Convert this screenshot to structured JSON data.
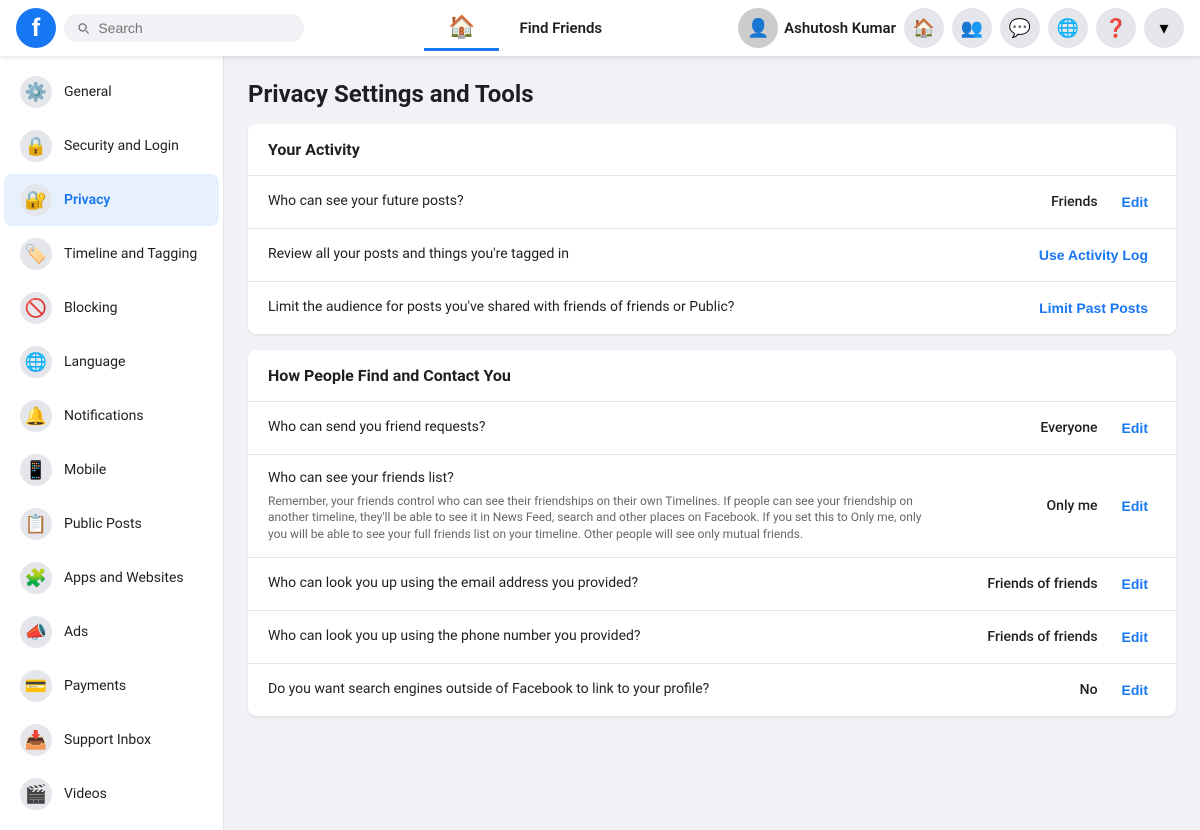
{
  "topnav": {
    "logo": "f",
    "search_placeholder": "Search",
    "user_name": "Ashutosh Kumar",
    "nav_items": [
      {
        "label": "Home",
        "icon": "🏠",
        "active": false
      },
      {
        "label": "Find Friends",
        "icon": "👥",
        "active": false
      }
    ],
    "icon_buttons": [
      {
        "name": "friends-icon",
        "symbol": "👤"
      },
      {
        "name": "messenger-icon",
        "symbol": "💬"
      },
      {
        "name": "globe-icon",
        "symbol": "🌐"
      },
      {
        "name": "help-icon",
        "symbol": "❓"
      },
      {
        "name": "chevron-icon",
        "symbol": "▾"
      }
    ]
  },
  "sidebar": {
    "items": [
      {
        "id": "general",
        "label": "General",
        "icon": "⚙️",
        "active": false
      },
      {
        "id": "security",
        "label": "Security and Login",
        "icon": "🔒",
        "active": false
      },
      {
        "id": "privacy",
        "label": "Privacy",
        "icon": "🔐",
        "active": true
      },
      {
        "id": "timeline",
        "label": "Timeline and Tagging",
        "icon": "🏷️",
        "active": false
      },
      {
        "id": "blocking",
        "label": "Blocking",
        "icon": "🚫",
        "active": false
      },
      {
        "id": "language",
        "label": "Language",
        "icon": "🌐",
        "active": false
      },
      {
        "id": "notifications",
        "label": "Notifications",
        "icon": "🔔",
        "active": false
      },
      {
        "id": "mobile",
        "label": "Mobile",
        "icon": "📱",
        "active": false
      },
      {
        "id": "public-posts",
        "label": "Public Posts",
        "icon": "📋",
        "active": false
      },
      {
        "id": "apps",
        "label": "Apps and Websites",
        "icon": "🧩",
        "active": false
      },
      {
        "id": "ads",
        "label": "Ads",
        "icon": "📣",
        "active": false
      },
      {
        "id": "payments",
        "label": "Payments",
        "icon": "💳",
        "active": false
      },
      {
        "id": "support",
        "label": "Support Inbox",
        "icon": "📥",
        "active": false
      },
      {
        "id": "videos",
        "label": "Videos",
        "icon": "🎬",
        "active": false
      }
    ]
  },
  "main": {
    "title": "Privacy Settings and Tools",
    "sections": [
      {
        "id": "your-activity",
        "header": "Your Activity",
        "rows": [
          {
            "description": "Who can see your future posts?",
            "sub_text": "",
            "value": "Friends",
            "action_label": "Edit",
            "action_type": "edit"
          },
          {
            "description": "Review all your posts and things you're tagged in",
            "sub_text": "",
            "value": "",
            "action_label": "Use Activity Log",
            "action_type": "log"
          },
          {
            "description": "Limit the audience for posts you've shared with friends of friends or Public?",
            "sub_text": "",
            "value": "",
            "action_label": "Limit Past Posts",
            "action_type": "limit"
          }
        ]
      },
      {
        "id": "how-people-find",
        "header": "How People Find and Contact You",
        "rows": [
          {
            "description": "Who can send you friend requests?",
            "sub_text": "",
            "value": "Everyone",
            "action_label": "Edit",
            "action_type": "edit"
          },
          {
            "description": "Who can see your friends list?",
            "sub_text": "Remember, your friends control who can see their friendships on their own Timelines. If people can see your friendship on another timeline, they'll be able to see it in News Feed, search and other places on Facebook. If you set this to Only me, only you will be able to see your full friends list on your timeline. Other people will see only mutual friends.",
            "value": "Only me",
            "action_label": "Edit",
            "action_type": "edit"
          },
          {
            "description": "Who can look you up using the email address you provided?",
            "sub_text": "",
            "value": "Friends of friends",
            "action_label": "Edit",
            "action_type": "edit"
          },
          {
            "description": "Who can look you up using the phone number you provided?",
            "sub_text": "",
            "value": "Friends of friends",
            "action_label": "Edit",
            "action_type": "edit"
          },
          {
            "description": "Do you want search engines outside of Facebook to link to your profile?",
            "sub_text": "",
            "value": "No",
            "action_label": "Edit",
            "action_type": "edit"
          }
        ]
      }
    ]
  },
  "colors": {
    "brand": "#1877f2",
    "bg": "#f0f2f5",
    "text_primary": "#1c1e21",
    "text_secondary": "#65676b",
    "border": "#e4e6eb"
  }
}
